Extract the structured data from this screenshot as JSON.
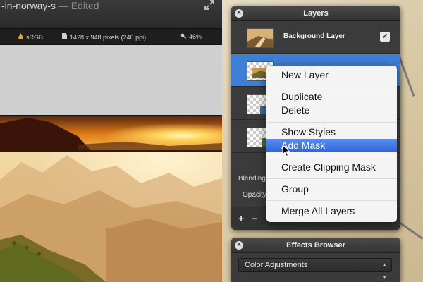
{
  "document": {
    "title": "-in-norway-s",
    "edited": " — Edited",
    "color_profile": "sRGB",
    "dimensions": "1428 x 948 pixels (240 ppi)",
    "zoom": "46%",
    "icons": {
      "color_profile": "drop-icon",
      "dimensions": "document-icon",
      "zoom": "magnifier-icon",
      "fullscreen": "expand-arrows-icon"
    }
  },
  "layers_panel": {
    "title": "Layers",
    "layers": [
      {
        "name": "Background Layer",
        "visible": true
      },
      {
        "name": "",
        "selected": true
      }
    ],
    "blending_label": "Blending",
    "opacity_label": "Opacity",
    "footer": {
      "add": "+",
      "remove": "−"
    }
  },
  "context_menu": {
    "items": [
      "New Layer",
      "Duplicate",
      "Delete",
      "Show Styles",
      "Add Mask",
      "Create Clipping Mask",
      "Group",
      "Merge All Layers"
    ],
    "highlighted": "Add Mask"
  },
  "effects_browser": {
    "title": "Effects Browser",
    "selected_category": "Color Adjustments"
  },
  "colors": {
    "selection_blue": "#3d7fd4",
    "menu_highlight": "#3a6fe0",
    "panel_bg": "#3b3b3b"
  }
}
